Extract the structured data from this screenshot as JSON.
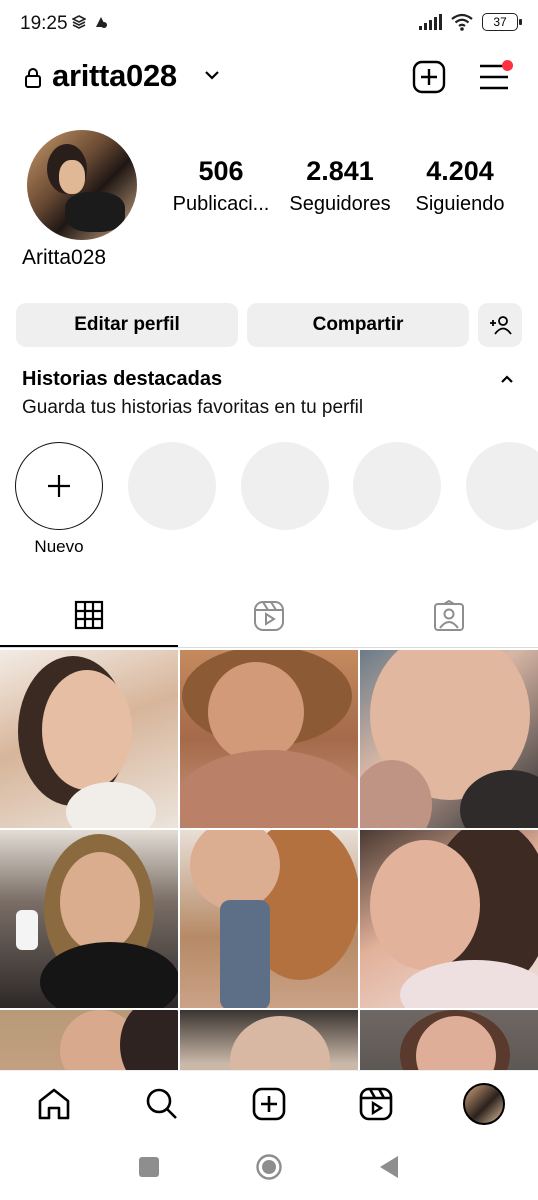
{
  "status_bar": {
    "time": "19:25",
    "battery": "37"
  },
  "header": {
    "username": "aritta028"
  },
  "profile": {
    "display_name": "Aritta028",
    "stats": [
      {
        "value": "506",
        "label": "Publicaci..."
      },
      {
        "value": "2.841",
        "label": "Seguidores"
      },
      {
        "value": "4.204",
        "label": "Siguiendo"
      }
    ]
  },
  "buttons": {
    "edit": "Editar perfil",
    "share": "Compartir"
  },
  "highlights": {
    "title": "Historias destacadas",
    "subtitle": "Guarda tus historias favoritas en tu perfil",
    "new_label": "Nuevo"
  },
  "tabs": [
    {
      "icon": "grid-icon",
      "selected": true
    },
    {
      "icon": "reels-icon",
      "selected": false
    },
    {
      "icon": "tagged-icon",
      "selected": false
    }
  ],
  "bottom_nav": [
    "home-icon",
    "search-icon",
    "create-icon",
    "reels-icon",
    "profile-avatar"
  ],
  "colors": {
    "notification_dot": "#ff3040",
    "button_bg": "#efefef",
    "placeholder": "#efefef"
  }
}
